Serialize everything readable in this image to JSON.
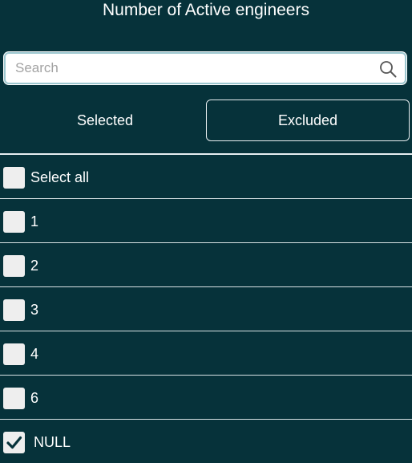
{
  "filter": {
    "title": "Number of Active engineers",
    "search": {
      "placeholder": "Search",
      "value": ""
    },
    "tabs": {
      "selected": "Selected",
      "excluded": "Excluded"
    },
    "select_all": {
      "label": "Select all",
      "checked": false
    },
    "options": [
      {
        "label": "1",
        "checked": false
      },
      {
        "label": "2",
        "checked": false
      },
      {
        "label": "3",
        "checked": false
      },
      {
        "label": "4",
        "checked": false
      },
      {
        "label": "6",
        "checked": false
      },
      {
        "label": "NULL",
        "checked": true
      }
    ]
  },
  "colors": {
    "background": "#06323a",
    "text": "#ffffff",
    "checkbox_fill": "#eeeeee",
    "check_mark": "#06323a"
  },
  "icons": {
    "search": "search-icon",
    "check": "checkmark-icon"
  }
}
